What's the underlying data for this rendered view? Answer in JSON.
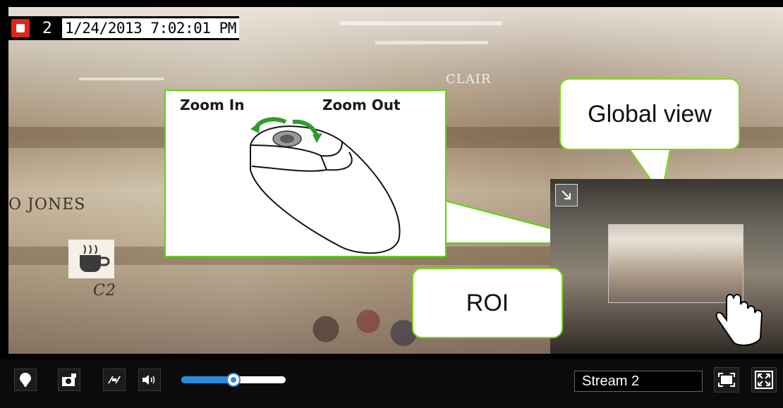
{
  "osd": {
    "channel": "2",
    "timestamp": "1/24/2013 7:02:01 PM",
    "record_icon": "record-icon"
  },
  "video": {
    "store_signs": [
      "O JONES",
      "C2"
    ],
    "cafe_sign": "CLAIR"
  },
  "mouse_callout": {
    "zoom_in_label": "Zoom In",
    "zoom_out_label": "Zoom Out",
    "accent_color": "#5ad60a"
  },
  "global_view_callout": {
    "label": "Global view"
  },
  "roi_callout": {
    "label": "ROI"
  },
  "toolbar": {
    "buttons": [
      "pin-icon",
      "snapshot-icon",
      "pip-icon",
      "volume-icon"
    ],
    "volume_level": 0.5,
    "stream_label": "Stream 2",
    "right_buttons": [
      "fit-screen-icon",
      "fullscreen-icon"
    ]
  },
  "colors": {
    "accent_green": "#7fd71a",
    "slider_blue": "#2d8be0",
    "record_red": "#e2231a"
  }
}
